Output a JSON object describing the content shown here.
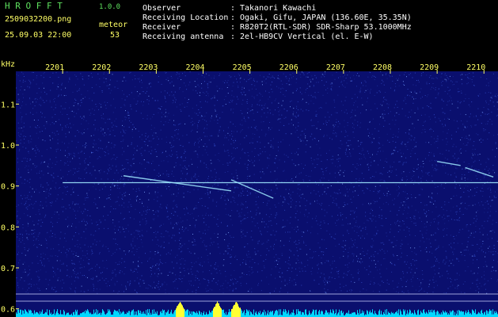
{
  "header": {
    "app_name": "H R O F F T",
    "version": "1.0.0",
    "filename": "2509032200.png",
    "datetime": "25.09.03 22:00",
    "mode": "meteor",
    "count": "53",
    "fields": [
      {
        "label": "Observer",
        "value": "Takanori Kawachi"
      },
      {
        "label": "Receiving Location",
        "value": "Ogaki, Gifu, JAPAN (136.60E, 35.35N)"
      },
      {
        "label": "Receiver",
        "value": "R820T2(RTL-SDR) SDR-Sharp 53.1000MHz"
      },
      {
        "label": "Receiving antenna",
        "value": "2el-HB9CV Vertical (el. E-W)"
      }
    ]
  },
  "colors": {
    "background": "#000000",
    "plot_bg": "#0a0f6e",
    "noise": "#3a58d8",
    "signal": "#9fe8ff",
    "header_green": "#5fe35f",
    "header_yellow": "#ffff66",
    "axis_text": "#ffff66",
    "bottom_bars": "#00d8ff",
    "bottom_peaks": "#ffff33"
  },
  "chart_data": {
    "type": "heatmap",
    "ylabel": "kHz",
    "x_ticks": [
      "2201",
      "2202",
      "2203",
      "2204",
      "2205",
      "2206",
      "2207",
      "2208",
      "2209",
      "2210"
    ],
    "y_ticks": [
      "1.1",
      "1.0",
      "0.9",
      "0.8",
      "0.7",
      "0.6"
    ],
    "ylim": [
      0.58,
      1.18
    ],
    "xlim": [
      2200.0,
      2210.3
    ],
    "carrier_khz": 0.908,
    "echoes": [
      {
        "x_start": 2202.3,
        "x_end": 2204.6,
        "y_start": 0.925,
        "y_end": 0.888
      },
      {
        "x_start": 2204.6,
        "x_end": 2205.5,
        "y_start": 0.915,
        "y_end": 0.87
      },
      {
        "x_start": 2209.0,
        "x_end": 2209.5,
        "y_start": 0.96,
        "y_end": 0.95
      },
      {
        "x_start": 2209.6,
        "x_end": 2210.2,
        "y_start": 0.945,
        "y_end": 0.922
      }
    ],
    "bottom_peaks_at": [
      2203.5,
      2204.3,
      2204.7
    ]
  }
}
